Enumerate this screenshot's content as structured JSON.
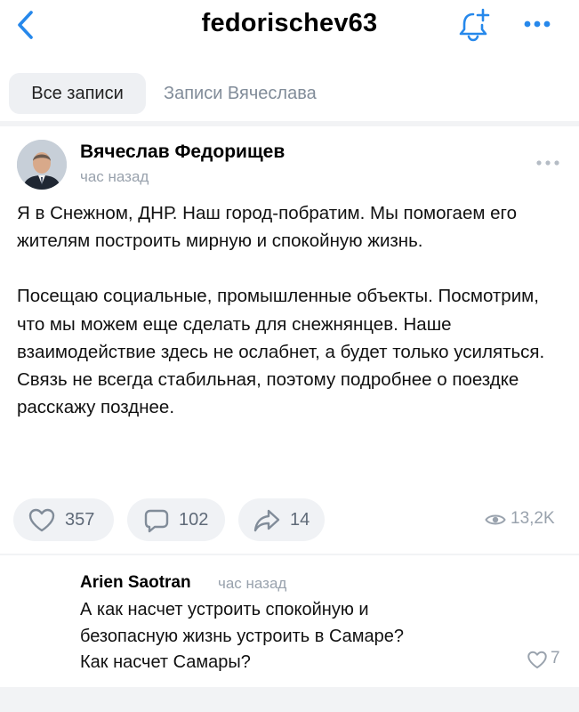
{
  "header": {
    "title": "fedorischev63",
    "back_icon": "chevron-left-icon",
    "bell_icon": "bell-plus-icon",
    "more_icon": "more-horizontal-icon",
    "accent_color": "#2688eb"
  },
  "tabs": [
    {
      "label": "Все записи",
      "active": true
    },
    {
      "label": "Записи Вячеслава",
      "active": false
    }
  ],
  "post": {
    "author": "Вячеслав Федорищев",
    "time": "час назад",
    "paragraphs": [
      "Я в Снежном, ДНР. Наш город-побратим. Мы помогаем его жителям построить мирную и спокойную жизнь.",
      "Посещаю социальные, промышленные объекты. Посмотрим, что мы можем еще сделать для снежнянцев. Наше взаимодействие здесь не ослабнет, а будет только усиляться. Связь не всегда стабильная, поэтому подробнее о поездке расскажу позднее."
    ],
    "likes": "357",
    "comments": "102",
    "shares": "14",
    "views": "13,2K"
  },
  "comment": {
    "author": "Arien Saotran",
    "time": "час назад",
    "lines": [
      "А как насчет устроить спокойную и",
      "безопасную жизнь устроить в Самаре?",
      "Как насчет Самары?"
    ],
    "likes": "7"
  }
}
